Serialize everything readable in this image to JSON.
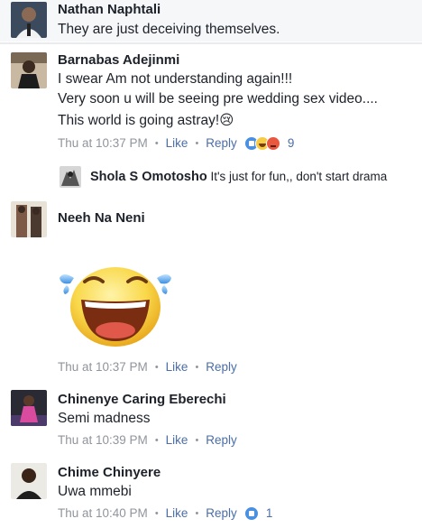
{
  "comments": [
    {
      "author": "Nathan Naphtali",
      "lines": [
        "They are just deceiving themselves."
      ]
    },
    {
      "author": "Barnabas Adejinmi",
      "lines": [
        "I swear Am not understanding again!!!",
        "Very soon u will be seeing pre wedding sex video....",
        "This world is going astray!😢"
      ],
      "time": "Thu at 10:37 PM",
      "like_label": "Like",
      "reply_label": "Reply",
      "reaction_count": "9",
      "reactions": [
        "like-reaction",
        "haha-reaction",
        "angry-reaction"
      ]
    },
    {
      "author": "Neeh Na Neni",
      "lines": [],
      "sticker": "laughing-face-sticker",
      "time": "Thu at 10:37 PM",
      "like_label": "Like",
      "reply_label": "Reply"
    },
    {
      "author": "Chinenye Caring Eberechi",
      "lines": [
        "Semi madness"
      ],
      "time": "Thu at 10:39 PM",
      "like_label": "Like",
      "reply_label": "Reply"
    },
    {
      "author": "Chime Chinyere",
      "lines": [
        "Uwa mmebi"
      ],
      "time": "Thu at 10:40 PM",
      "like_label": "Like",
      "reply_label": "Reply",
      "reaction_count": "1",
      "reactions": [
        "like-reaction"
      ]
    }
  ],
  "reply": {
    "author": "Shola S Omotosho",
    "text": "It's just for fun,, don't start drama"
  },
  "colors": {
    "link": "#4b6ea7",
    "meta": "#90949c",
    "like_reaction": "#4a90e2"
  }
}
